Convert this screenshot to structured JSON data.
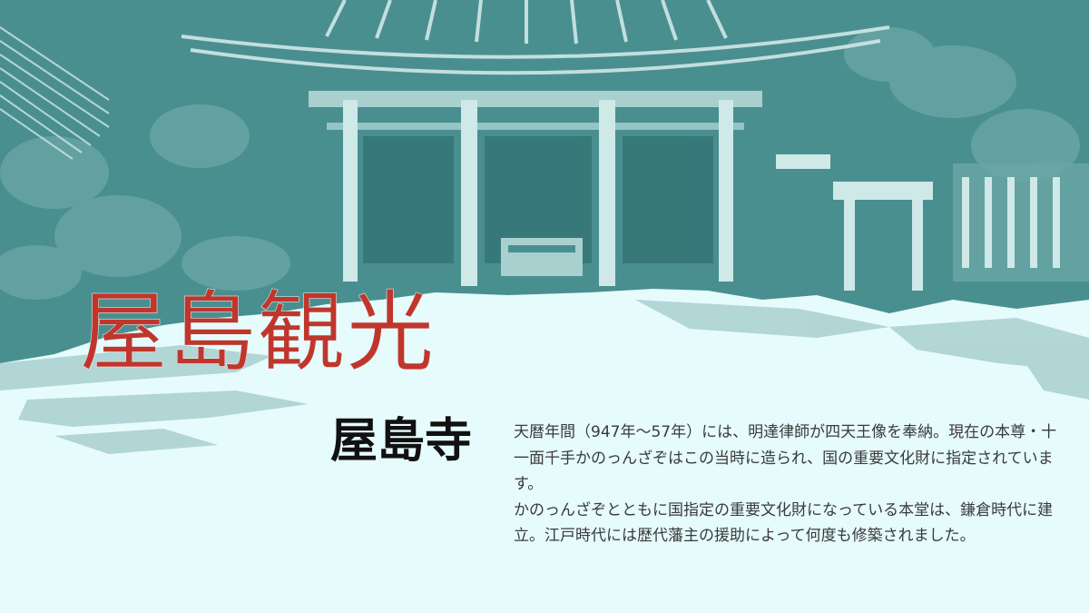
{
  "slide": {
    "title": "屋島観光",
    "subtitle": "屋島寺",
    "paragraphs": [
      "天暦年間（947年～57年）には、明達律師が四天王像を奉納。現在の本尊・十一面千手かのっんざぞはこの当時に造られ、国の重要文化財に指定されています。",
      "かのっんざぞとともに国指定の重要文化財になっている本堂は、鎌倉時代に建立。江戸時代には歴代藩主の援助によって何度も修築されました。"
    ]
  },
  "colors": {
    "background": "#e6fbfb",
    "illustration_teal": "#4a8f90",
    "illustration_light": "#a9cfcf",
    "title_red": "#c0362c",
    "subtitle_black": "#111111",
    "body_text": "#3a3a3a"
  },
  "illustration": {
    "subject": "temple-hall-illustration",
    "icon": "temple-building-icon"
  }
}
